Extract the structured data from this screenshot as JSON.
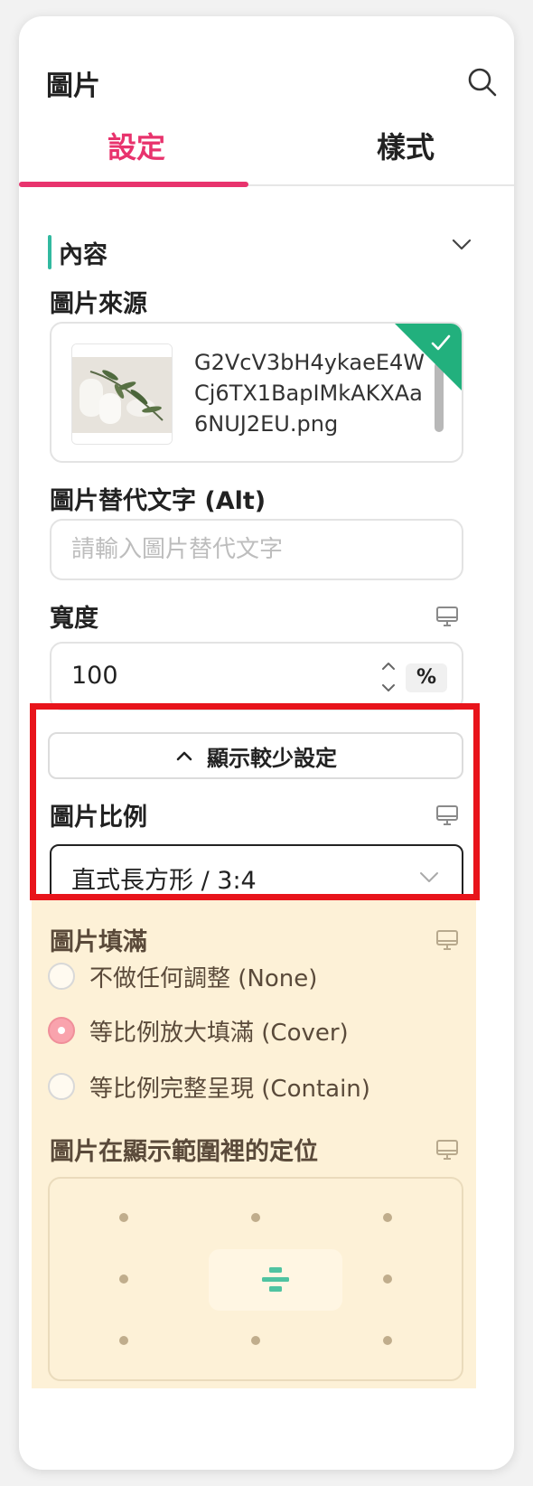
{
  "header": {
    "title": "圖片",
    "search_icon": "search-icon"
  },
  "tabs": [
    {
      "label": "設定",
      "active": true
    },
    {
      "label": "樣式",
      "active": false
    }
  ],
  "colors": {
    "accent": "#e8336d",
    "section_bar": "#32b9a0",
    "success": "#22b07d",
    "highlight": "#e8141b",
    "disabled_bg": "#fdf1d7"
  },
  "section": {
    "title": "內容"
  },
  "image_source": {
    "label": "圖片來源",
    "filename": "G2VcV3bH4ykaeE4WCj6TX1BapIMkAKXAa6NUJ2EU.png"
  },
  "alt_text": {
    "label": "圖片替代文字 (Alt)",
    "placeholder": "請輸入圖片替代文字",
    "value": ""
  },
  "width": {
    "label": "寬度",
    "value": "100",
    "unit": "%"
  },
  "show_less": {
    "label": "顯示較少設定"
  },
  "aspect_ratio": {
    "label": "圖片比例",
    "selected": "直式長方形 / 3:4"
  },
  "fill": {
    "label": "圖片填滿",
    "options": [
      {
        "label": "不做任何調整 (None)",
        "checked": false
      },
      {
        "label": "等比例放大填滿 (Cover)",
        "checked": true
      },
      {
        "label": "等比例完整呈現 (Contain)",
        "checked": false
      }
    ]
  },
  "position": {
    "label": "圖片在顯示範圍裡的定位",
    "selected": "center"
  }
}
